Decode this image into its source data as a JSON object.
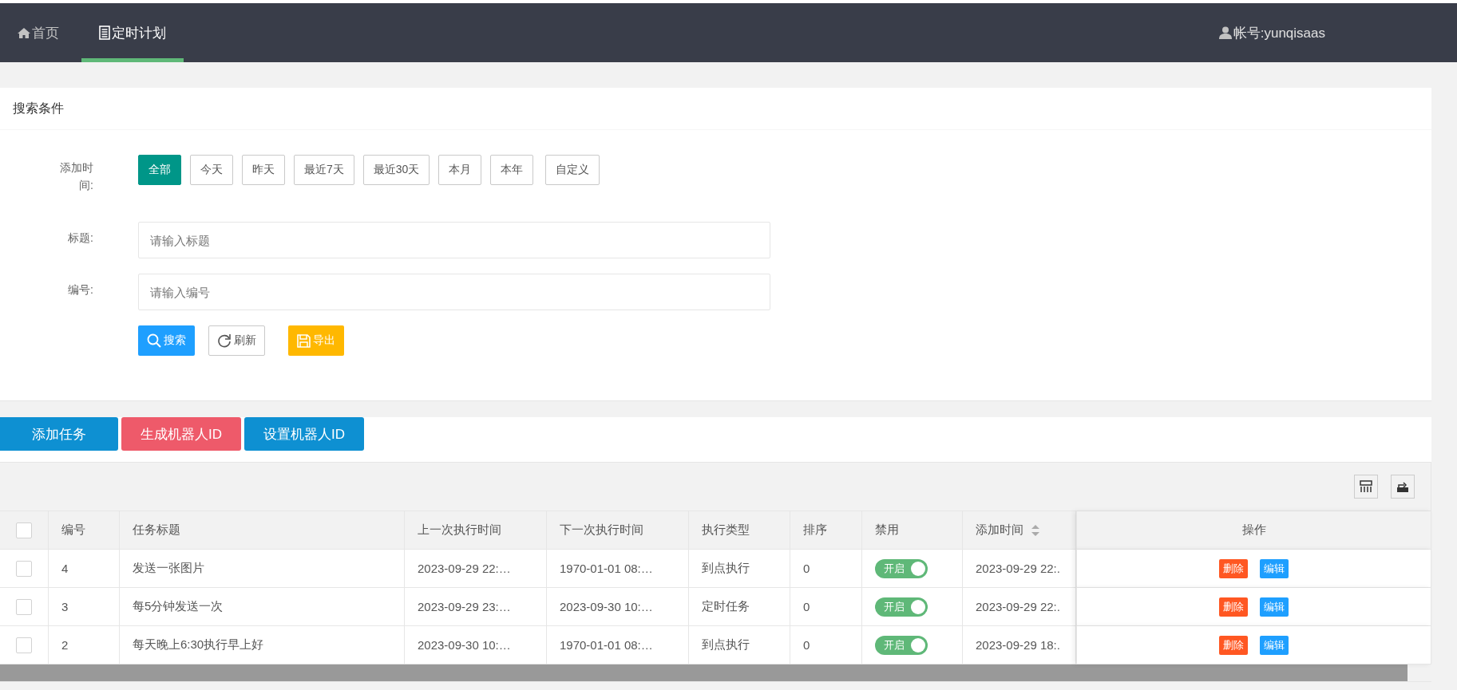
{
  "nav": {
    "tabs": [
      {
        "label": "首页",
        "selected": false
      },
      {
        "label": "定时计划",
        "selected": true
      }
    ],
    "account": "帐号:yunqisaas"
  },
  "search": {
    "title": "搜索条件",
    "date_label": "添加时间:",
    "date_options": [
      {
        "label": "全部",
        "selected": true
      },
      {
        "label": "今天",
        "selected": false
      },
      {
        "label": "昨天",
        "selected": false
      },
      {
        "label": "最近7天",
        "selected": false
      },
      {
        "label": "最近30天",
        "selected": false
      },
      {
        "label": "本月",
        "selected": false
      },
      {
        "label": "本年",
        "selected": false
      },
      {
        "label": "自定义",
        "selected": false
      }
    ],
    "fields": [
      {
        "label": "标题:",
        "placeholder": "请输入标题"
      },
      {
        "label": "编号:",
        "placeholder": "请输入编号"
      }
    ],
    "buttons": [
      {
        "kind": "search",
        "label": "搜索"
      },
      {
        "kind": "refresh",
        "label": "刷新"
      },
      {
        "kind": "export",
        "label": "导出"
      }
    ]
  },
  "actions": [
    {
      "label": "添加任务",
      "color": "#0e90d2"
    },
    {
      "label": "生成机器人ID",
      "color": "#ee5a6a"
    },
    {
      "label": "设置机器人ID",
      "color": "#0e90d2"
    }
  ],
  "table": {
    "select_all_checked": false,
    "columns": [
      "编号",
      "任务标题",
      "上一次执行时间",
      "下一次执行时间",
      "执行类型",
      "排序",
      "禁用",
      "添加时间",
      "操作"
    ],
    "rows": [
      {
        "checked": false,
        "id": "4",
        "title": "发送一张图片",
        "last_run": "2023-09-29 22:…",
        "next_run": "1970-01-01 08:…",
        "type": "到点执行",
        "order": "0",
        "switch": {
          "label": "开启",
          "on": true
        },
        "added": "2023-09-29 22:.",
        "delete": "删除",
        "edit": "编辑"
      },
      {
        "checked": false,
        "id": "3",
        "title": "每5分钟发送一次",
        "last_run": "2023-09-29 23:…",
        "next_run": "2023-09-30 10:…",
        "type": "定时任务",
        "order": "0",
        "switch": {
          "label": "开启",
          "on": true
        },
        "added": "2023-09-29 22:.",
        "delete": "删除",
        "edit": "编辑"
      },
      {
        "checked": false,
        "id": "2",
        "title": "每天晚上6:30执行早上好",
        "last_run": "2023-09-30 10:…",
        "next_run": "1970-01-01 08:…",
        "type": "到点执行",
        "order": "0",
        "switch": {
          "label": "开启",
          "on": true
        },
        "added": "2023-09-29 18:.",
        "delete": "删除",
        "edit": "编辑"
      }
    ]
  }
}
